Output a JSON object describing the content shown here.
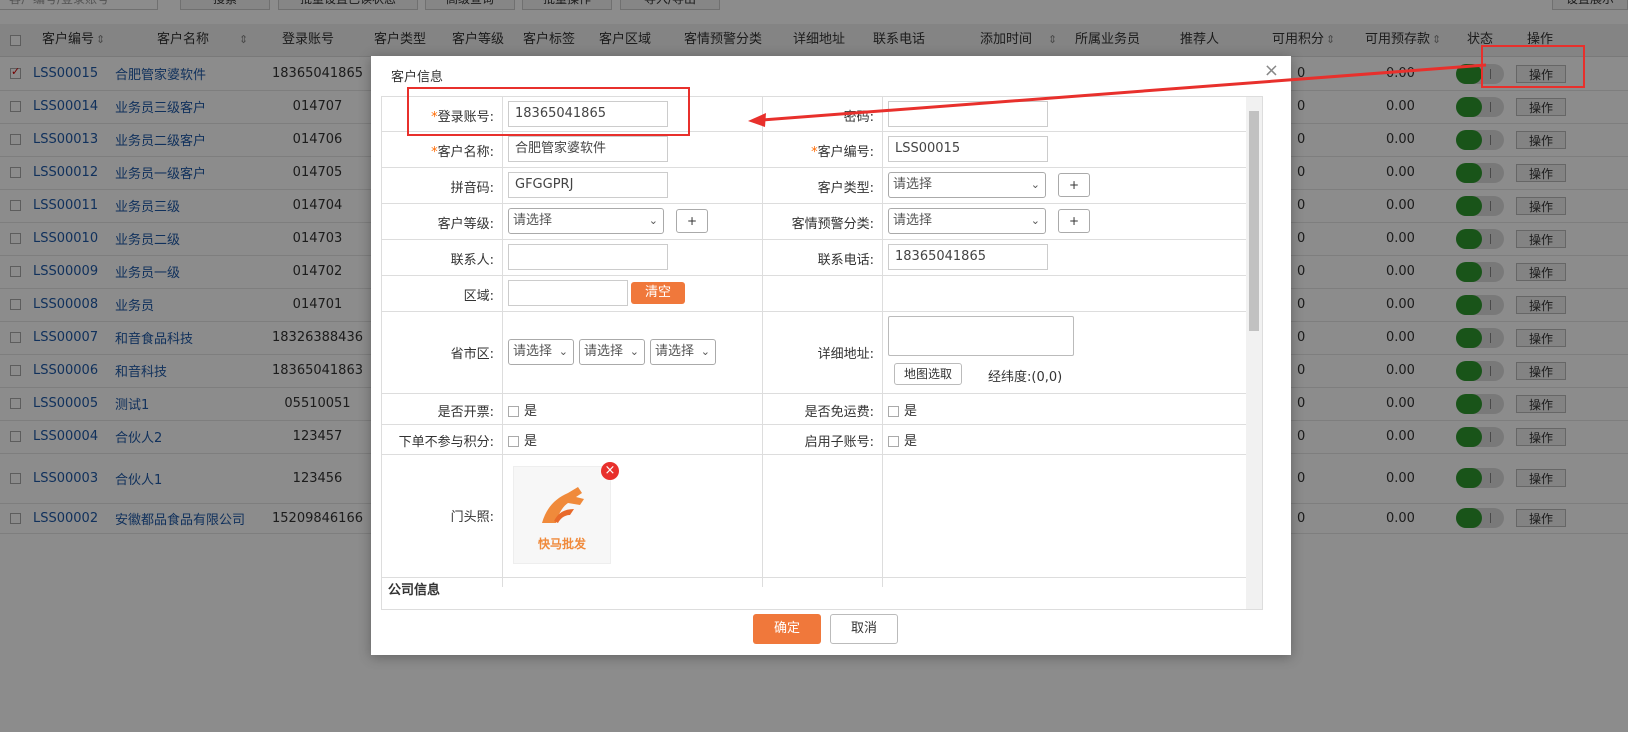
{
  "toolbar": {
    "search_placeholder": "客户编号/登录账号",
    "buttons": [
      "搜索",
      "批量设置已读状态",
      "高级查询",
      "批量操作",
      "导入/导出"
    ],
    "right_button": "设置展示"
  },
  "table": {
    "headers": [
      "客户编号",
      "客户名称",
      "登录账号",
      "客户类型",
      "客户等级",
      "客户标签",
      "客户区域",
      "客情预警分类",
      "详细地址",
      "联系电话",
      "添加时间",
      "所属业务员",
      "推荐人",
      "可用积分",
      "可用预存款",
      "状态",
      "操作"
    ],
    "rows": [
      {
        "code": "LSS00015",
        "name": "合肥管家婆软件",
        "account": "18365041865",
        "points": "0",
        "deposit": "0.00",
        "op": "操作",
        "checked": true
      },
      {
        "code": "LSS00014",
        "name": "业务员三级客户",
        "account": "014707",
        "points": "0",
        "deposit": "0.00",
        "op": "操作",
        "checked": false
      },
      {
        "code": "LSS00013",
        "name": "业务员二级客户",
        "account": "014706",
        "points": "0",
        "deposit": "0.00",
        "op": "操作",
        "checked": false
      },
      {
        "code": "LSS00012",
        "name": "业务员一级客户",
        "account": "014705",
        "points": "0",
        "deposit": "0.00",
        "op": "操作",
        "checked": false
      },
      {
        "code": "LSS00011",
        "name": "业务员三级",
        "account": "014704",
        "points": "0",
        "deposit": "0.00",
        "op": "操作",
        "checked": false
      },
      {
        "code": "LSS00010",
        "name": "业务员二级",
        "account": "014703",
        "points": "0",
        "deposit": "0.00",
        "op": "操作",
        "checked": false
      },
      {
        "code": "LSS00009",
        "name": "业务员一级",
        "account": "014702",
        "points": "0",
        "deposit": "0.00",
        "op": "操作",
        "checked": false
      },
      {
        "code": "LSS00008",
        "name": "业务员",
        "account": "014701",
        "points": "0",
        "deposit": "0.00",
        "op": "操作",
        "checked": false
      },
      {
        "code": "LSS00007",
        "name": "和音食品科技",
        "account": "18326388436",
        "points": "0",
        "deposit": "0.00",
        "op": "操作",
        "checked": false
      },
      {
        "code": "LSS00006",
        "name": "和音科技",
        "account": "18365041863",
        "points": "0",
        "deposit": "0.00",
        "op": "操作",
        "checked": false
      },
      {
        "code": "LSS00005",
        "name": "测试1",
        "account": "05510051",
        "points": "0",
        "deposit": "0.00",
        "op": "操作",
        "checked": false
      },
      {
        "code": "LSS00004",
        "name": "合伙人2",
        "account": "123457",
        "points": "0",
        "deposit": "0.00",
        "op": "操作",
        "checked": false
      },
      {
        "code": "LSS00003",
        "name": "合伙人1",
        "account": "123456",
        "points": "0",
        "deposit": "0.00",
        "op": "操作",
        "checked": false
      },
      {
        "code": "LSS00002",
        "name": "安徽都品食品有限公司",
        "account": "15209846166",
        "points": "0",
        "deposit": "0.00",
        "op": "操作",
        "checked": false
      }
    ]
  },
  "modal": {
    "title": "客户信息",
    "close": "×",
    "labels": {
      "login": "登录账号:",
      "password": "密码:",
      "cust_name": "客户名称:",
      "cust_code": "客户编号:",
      "pinyin": "拼音码:",
      "cust_type": "客户类型:",
      "cust_level": "客户等级:",
      "warning": "客情预警分类:",
      "contact": "联系人:",
      "phone": "联系电话:",
      "region": "区域:",
      "province": "省市区:",
      "address": "详细地址:",
      "invoice": "是否开票:",
      "free_ship": "是否免运费:",
      "no_points": "下单不参与积分:",
      "sub_account": "启用子账号:",
      "storefront": "门头照:",
      "company_info": "公司信息"
    },
    "values": {
      "login": "18365041865",
      "password": "",
      "cust_name": "合肥管家婆软件",
      "cust_code": "LSS00015",
      "pinyin": "GFGGPRJ",
      "contact": "",
      "phone": "18365041865",
      "region": ""
    },
    "select_placeholder": "请选择",
    "plus": "+",
    "clear": "清空",
    "map_pick": "地图选取",
    "latlng_label": "经纬度:",
    "latlng_value": "(0,0)",
    "yes": "是",
    "logo_text": "快马批发",
    "confirm": "确定",
    "cancel": "取消"
  },
  "colors": {
    "accent": "#f0783b",
    "link": "#1f5aa8",
    "annotation": "#e8302c",
    "toggle_on": "#2f9a2f"
  }
}
